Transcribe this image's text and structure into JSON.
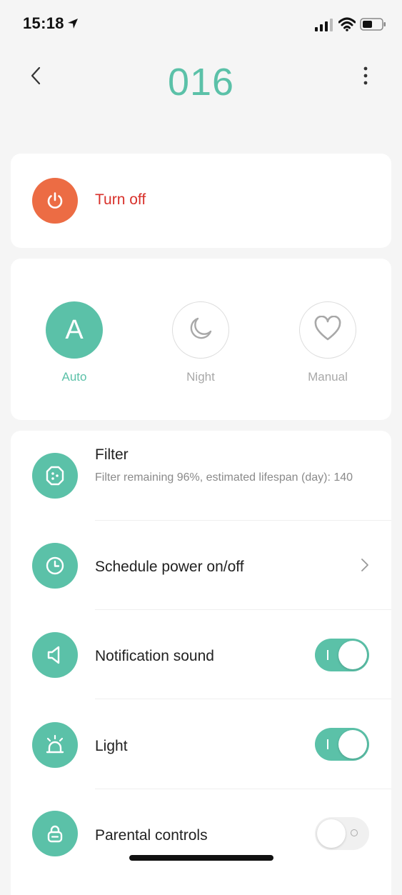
{
  "status_bar": {
    "time": "15:18",
    "icons": [
      "location-arrow-icon",
      "cellular-signal-icon",
      "wifi-icon",
      "battery-icon"
    ]
  },
  "header": {
    "title": "016",
    "back_icon": "chevron-left-icon",
    "more_icon": "more-vertical-icon"
  },
  "power": {
    "label": "Turn off",
    "icon": "power-icon",
    "color": "#ec6c44",
    "label_color": "#d8312b"
  },
  "modes": [
    {
      "label": "Auto",
      "symbol": "A",
      "active": true
    },
    {
      "label": "Night",
      "icon": "moon-icon",
      "active": false
    },
    {
      "label": "Manual",
      "icon": "heart-icon",
      "active": false
    }
  ],
  "settings": {
    "filter": {
      "title": "Filter",
      "subtitle": "Filter remaining 96%,  estimated lifespan (day): 140",
      "icon": "filter-icon"
    },
    "schedule": {
      "title": "Schedule power on/off",
      "icon": "clock-icon"
    },
    "notification": {
      "title": "Notification sound",
      "icon": "speaker-icon",
      "enabled": true
    },
    "light": {
      "title": "Light",
      "icon": "alarm-light-icon",
      "enabled": true
    },
    "parental": {
      "title": "Parental controls",
      "icon": "lock-icon",
      "enabled": false
    }
  },
  "colors": {
    "accent": "#5bc1a8",
    "background": "#f5f5f5",
    "card": "#ffffff"
  }
}
